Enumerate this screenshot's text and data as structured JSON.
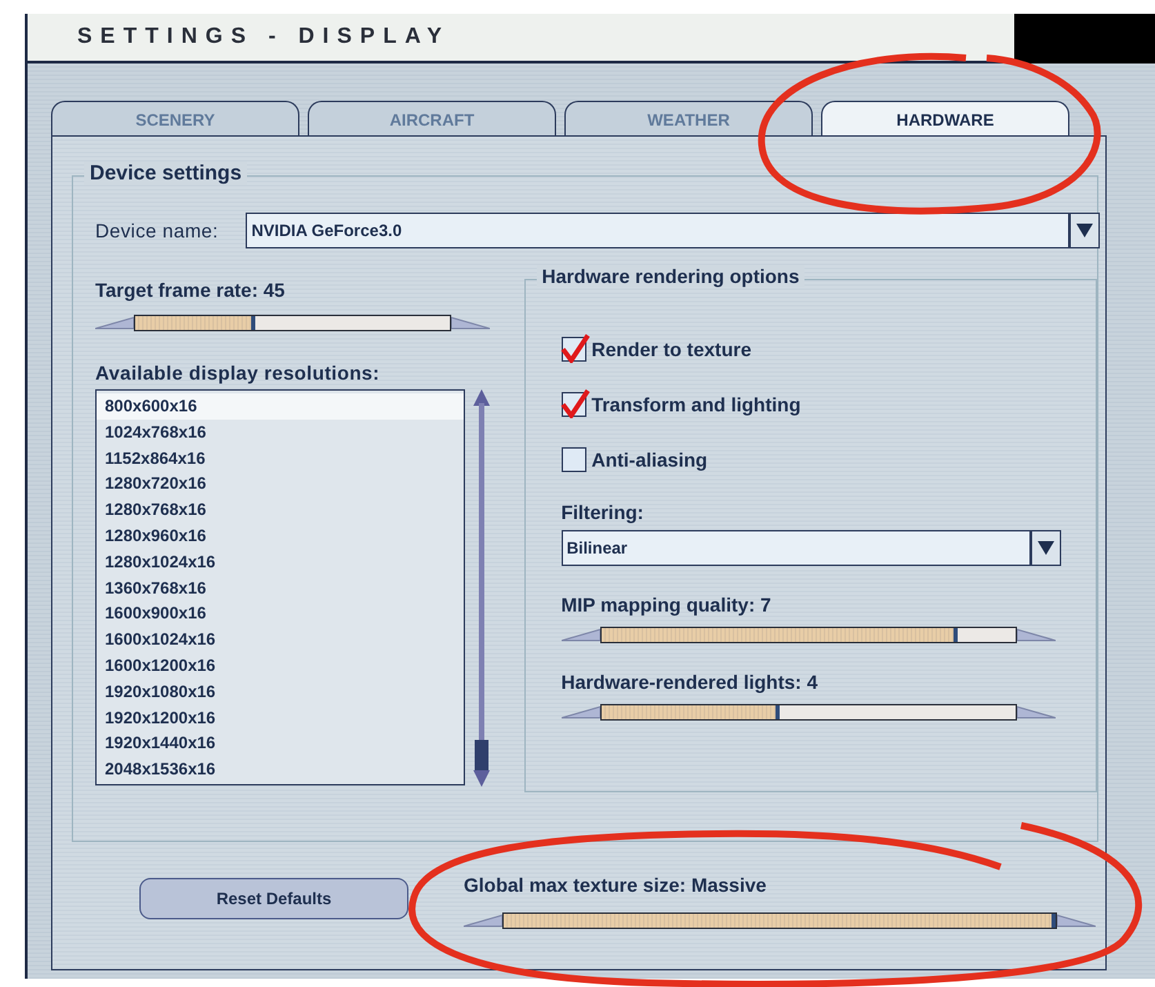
{
  "window": {
    "title": "SETTINGS - DISPLAY"
  },
  "tabs": [
    {
      "label": "SCENERY",
      "selected": false
    },
    {
      "label": "AIRCRAFT",
      "selected": false
    },
    {
      "label": "WEATHER",
      "selected": false
    },
    {
      "label": "HARDWARE",
      "selected": true
    }
  ],
  "device_settings": {
    "title": "Device settings",
    "device_name": {
      "label": "Device name:",
      "value": "NVIDIA GeForce3.0"
    },
    "frame_rate": {
      "label": "Target frame rate: 45",
      "level": 0.38
    },
    "resolutions": {
      "label": "Available display resolutions:",
      "items": [
        {
          "label": "800x600x16",
          "selected": true
        },
        {
          "label": "1024x768x16",
          "selected": false
        },
        {
          "label": "1152x864x16",
          "selected": false
        },
        {
          "label": "1280x720x16",
          "selected": false
        },
        {
          "label": "1280x768x16",
          "selected": false
        },
        {
          "label": "1280x960x16",
          "selected": false
        },
        {
          "label": "1280x1024x16",
          "selected": false
        },
        {
          "label": "1360x768x16",
          "selected": false
        },
        {
          "label": "1600x900x16",
          "selected": false
        },
        {
          "label": "1600x1024x16",
          "selected": false
        },
        {
          "label": "1600x1200x16",
          "selected": false
        },
        {
          "label": "1920x1080x16",
          "selected": false
        },
        {
          "label": "1920x1200x16",
          "selected": false
        },
        {
          "label": "1920x1440x16",
          "selected": false
        },
        {
          "label": "2048x1536x16",
          "selected": false
        }
      ]
    },
    "hardware_rendering": {
      "title": "Hardware rendering options",
      "options": [
        {
          "label": "Render to texture",
          "checked": true
        },
        {
          "label": "Transform and lighting",
          "checked": true
        },
        {
          "label": "Anti-aliasing",
          "checked": false
        }
      ],
      "filtering": {
        "label": "Filtering:",
        "value": "Bilinear"
      },
      "mip_quality": {
        "label": "MIP mapping quality: 7",
        "level": 0.86
      },
      "lights": {
        "label": "Hardware-rendered lights: 4",
        "level": 0.43
      }
    }
  },
  "reset_button": {
    "label": "Reset Defaults"
  },
  "texture_size": {
    "label": "Global max texture size: Massive",
    "level": 1.0
  }
}
